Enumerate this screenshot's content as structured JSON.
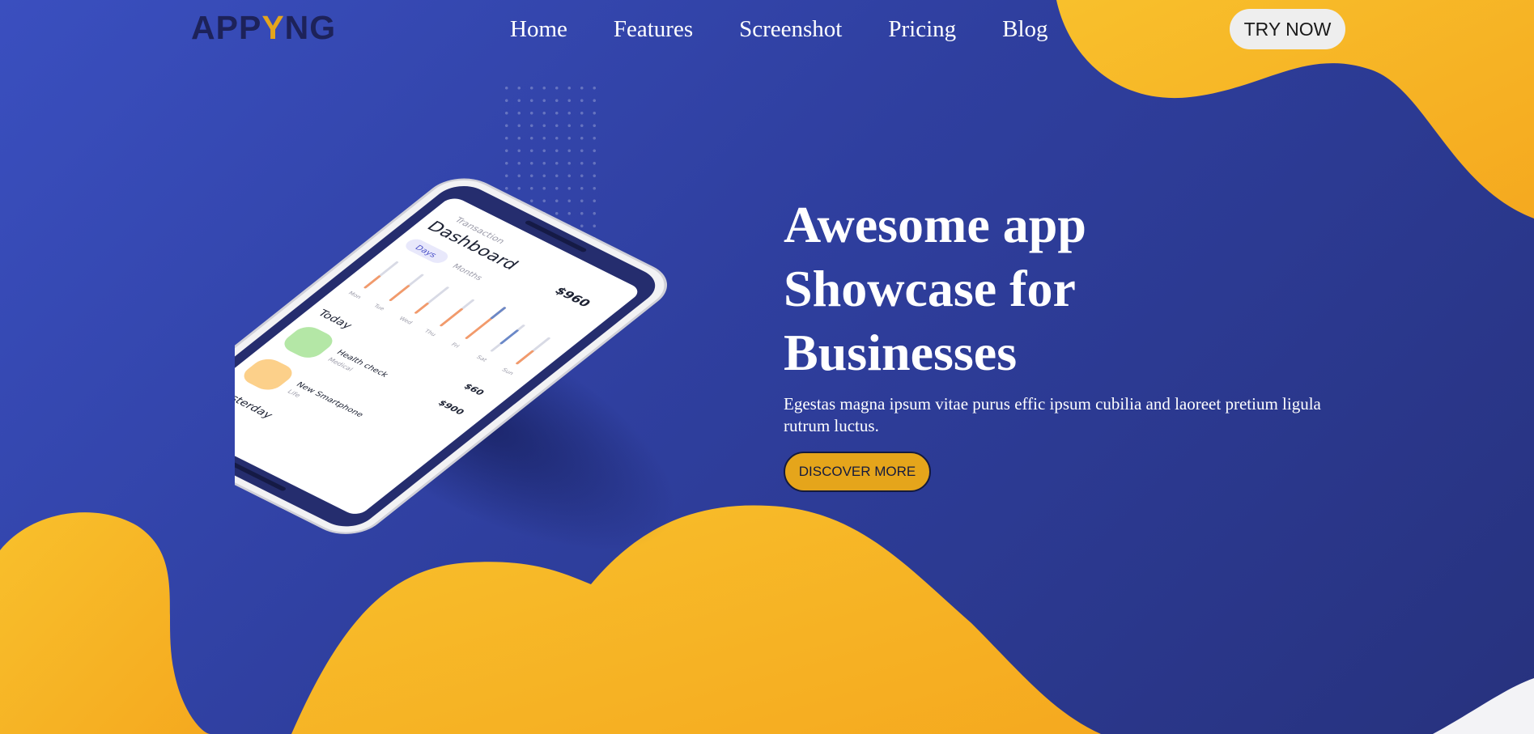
{
  "brand": {
    "logo_part1": "APP",
    "logo_accent": "Y",
    "logo_part2": "NG"
  },
  "nav": {
    "items": [
      {
        "label": "Home"
      },
      {
        "label": "Features"
      },
      {
        "label": "Screenshot"
      },
      {
        "label": "Pricing"
      },
      {
        "label": "Blog"
      }
    ]
  },
  "header": {
    "cta_label": "TRY NOW"
  },
  "hero": {
    "title_line1": "Awesome app",
    "title_line2": "Showcase for",
    "title_line3": "Businesses",
    "subtitle": "Egestas magna ipsum vitae purus effic ipsum cubilia and laoreet pretium ligula rutrum luctus.",
    "button_label": "DISCOVER MORE"
  },
  "phone_screen": {
    "eyebrow": "Transaction",
    "title": "Dashboard",
    "amount": "$960",
    "tab_active": "Days",
    "tab_inactive": "Months",
    "weekdays": [
      "Mon",
      "Tue",
      "Wed",
      "Thu",
      "Fri",
      "Sat",
      "Sun"
    ],
    "today_label": "Today",
    "today_amount": "$60",
    "items": [
      {
        "title": "Health check",
        "subtitle": "Medical",
        "amount": "$900"
      },
      {
        "title": "New Smartphone",
        "subtitle": "Life",
        "amount": ""
      }
    ],
    "yesterday_label": "Yesterday"
  },
  "colors": {
    "background_blue": "#2f3f9f",
    "accent_yellow": "#f7b825",
    "logo_navy": "#1d2259",
    "button_gold": "#e5a51b"
  }
}
